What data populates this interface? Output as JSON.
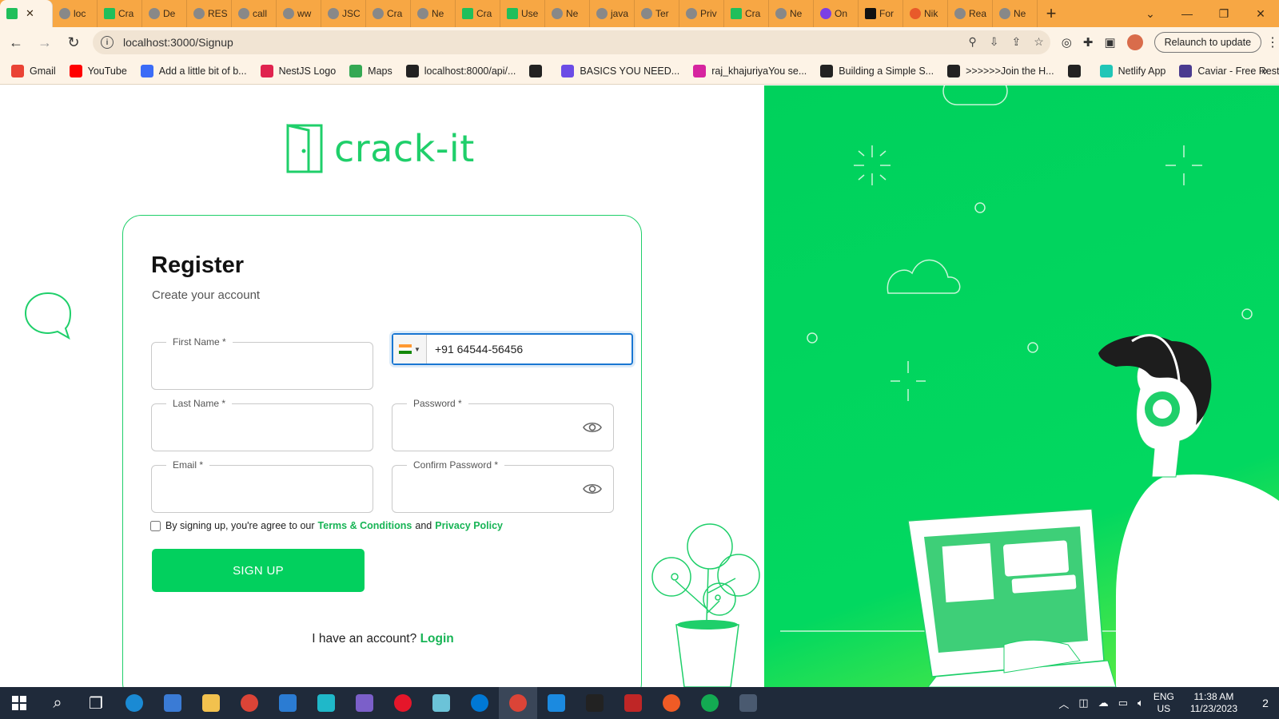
{
  "browser": {
    "tabs": [
      {
        "label": "",
        "favicon": "crack-it-icon",
        "active": true
      },
      {
        "label": "loc",
        "favicon": "globe-icon"
      },
      {
        "label": "Cra",
        "favicon": "plus-icon"
      },
      {
        "label": "De",
        "favicon": "deploy-icon"
      },
      {
        "label": "RES",
        "favicon": "openai-icon"
      },
      {
        "label": "call",
        "favicon": "github-icon"
      },
      {
        "label": "ww",
        "favicon": "compass-icon"
      },
      {
        "label": "JSC",
        "favicon": "rainbow-icon"
      },
      {
        "label": "Cra",
        "favicon": "globe-icon"
      },
      {
        "label": "Ne",
        "favicon": "nestjs-icon"
      },
      {
        "label": "Cra",
        "favicon": "crack-it-icon"
      },
      {
        "label": "Use",
        "favicon": "crack-it-icon"
      },
      {
        "label": "Ne",
        "favicon": "nestjs-icon"
      },
      {
        "label": "java",
        "favicon": "globe-icon"
      },
      {
        "label": "Ter",
        "favicon": "globe-icon"
      },
      {
        "label": "Priv",
        "favicon": "globe-icon"
      },
      {
        "label": "Cra",
        "favicon": "crack-it-icon"
      },
      {
        "label": "Ne",
        "favicon": "nestjs-icon"
      },
      {
        "label": "On",
        "favicon": "p-icon"
      },
      {
        "label": "For",
        "favicon": "square-icon"
      },
      {
        "label": "Nik",
        "favicon": "gitlab-icon"
      },
      {
        "label": "Rea",
        "favicon": "globe-icon"
      },
      {
        "label": "Ne",
        "favicon": "nestjs-icon"
      }
    ],
    "new_tab": "+",
    "url": "localhost:3000/Signup",
    "relaunch_label": "Relaunch to update",
    "bookmarks": [
      {
        "label": "Gmail",
        "color": "#ea4335"
      },
      {
        "label": "YouTube",
        "color": "#ff0000"
      },
      {
        "label": "Add a little bit of b...",
        "color": "#3b6cf7"
      },
      {
        "label": "NestJS Logo",
        "color": "#e0234e"
      },
      {
        "label": "Maps",
        "color": "#34a853"
      },
      {
        "label": "localhost:8000/api/...",
        "color": "#222222"
      },
      {
        "label": "",
        "color": "#222222"
      },
      {
        "label": "BASICS YOU NEED...",
        "color": "#6b4ce6"
      },
      {
        "label": "raj_khajuriyaYou se...",
        "color": "#d6249f"
      },
      {
        "label": "Building a Simple S...",
        "color": "#222222"
      },
      {
        "label": ">>>>>>Join the H...",
        "color": "#222222"
      },
      {
        "label": "",
        "color": "#222222"
      },
      {
        "label": "Netlify App",
        "color": "#20c6b7"
      },
      {
        "label": "Caviar - Free Restau...",
        "color": "#4a3b8f"
      }
    ]
  },
  "page": {
    "brand": "crack-it",
    "title": "Register",
    "subtitle": "Create your account",
    "fields": {
      "first_name": {
        "label": "First Name *",
        "value": ""
      },
      "last_name": {
        "label": "Last Name *",
        "value": ""
      },
      "email": {
        "label": "Email *",
        "value": ""
      },
      "password": {
        "label": "Password *",
        "value": ""
      },
      "confirm_password": {
        "label": "Confirm Password *",
        "value": ""
      },
      "phone": {
        "value": "+91 64544-56456",
        "country": "IN"
      }
    },
    "terms": {
      "prefix": "By signing up, you're agree to our",
      "terms_link": "Terms & Conditions",
      "and": "and",
      "privacy_link": "Privacy Policy"
    },
    "signup_label": "SIGN UP",
    "have_account": "I have an account?",
    "login_label": "Login",
    "accent_color": "#02d05e"
  },
  "taskbar": {
    "apps": [
      "windows-start",
      "search",
      "task-view",
      "edge",
      "store",
      "file-explorer",
      "chrome",
      "mail",
      "3d-viewer",
      "visual-studio",
      "opera",
      "notepad",
      "skype",
      "chrome-active",
      "vscode",
      "terminal",
      "filezilla",
      "postman",
      "mongodb-compass",
      "calculator"
    ],
    "lang": "ENG",
    "region": "US",
    "time": "11:38 AM",
    "date": "11/23/2023",
    "notifications": "2"
  }
}
